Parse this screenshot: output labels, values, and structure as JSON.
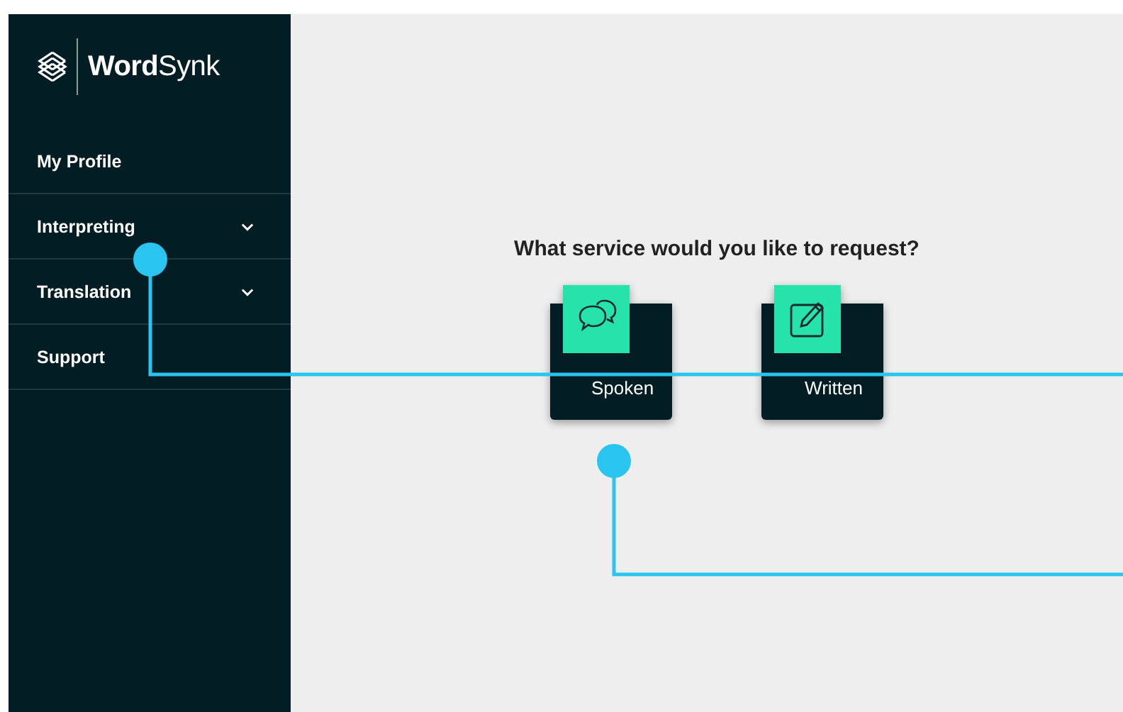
{
  "logo": {
    "bold": "Word",
    "light": "Synk"
  },
  "sidebar": {
    "items": [
      {
        "label": "My Profile",
        "expandable": false
      },
      {
        "label": "Interpreting",
        "expandable": true
      },
      {
        "label": "Translation",
        "expandable": true
      },
      {
        "label": "Support",
        "expandable": false
      }
    ]
  },
  "main": {
    "heading": "What service would you like to request?",
    "services": [
      {
        "label": "Spoken",
        "kind": "speech"
      },
      {
        "label": "Written",
        "kind": "edit"
      }
    ]
  }
}
